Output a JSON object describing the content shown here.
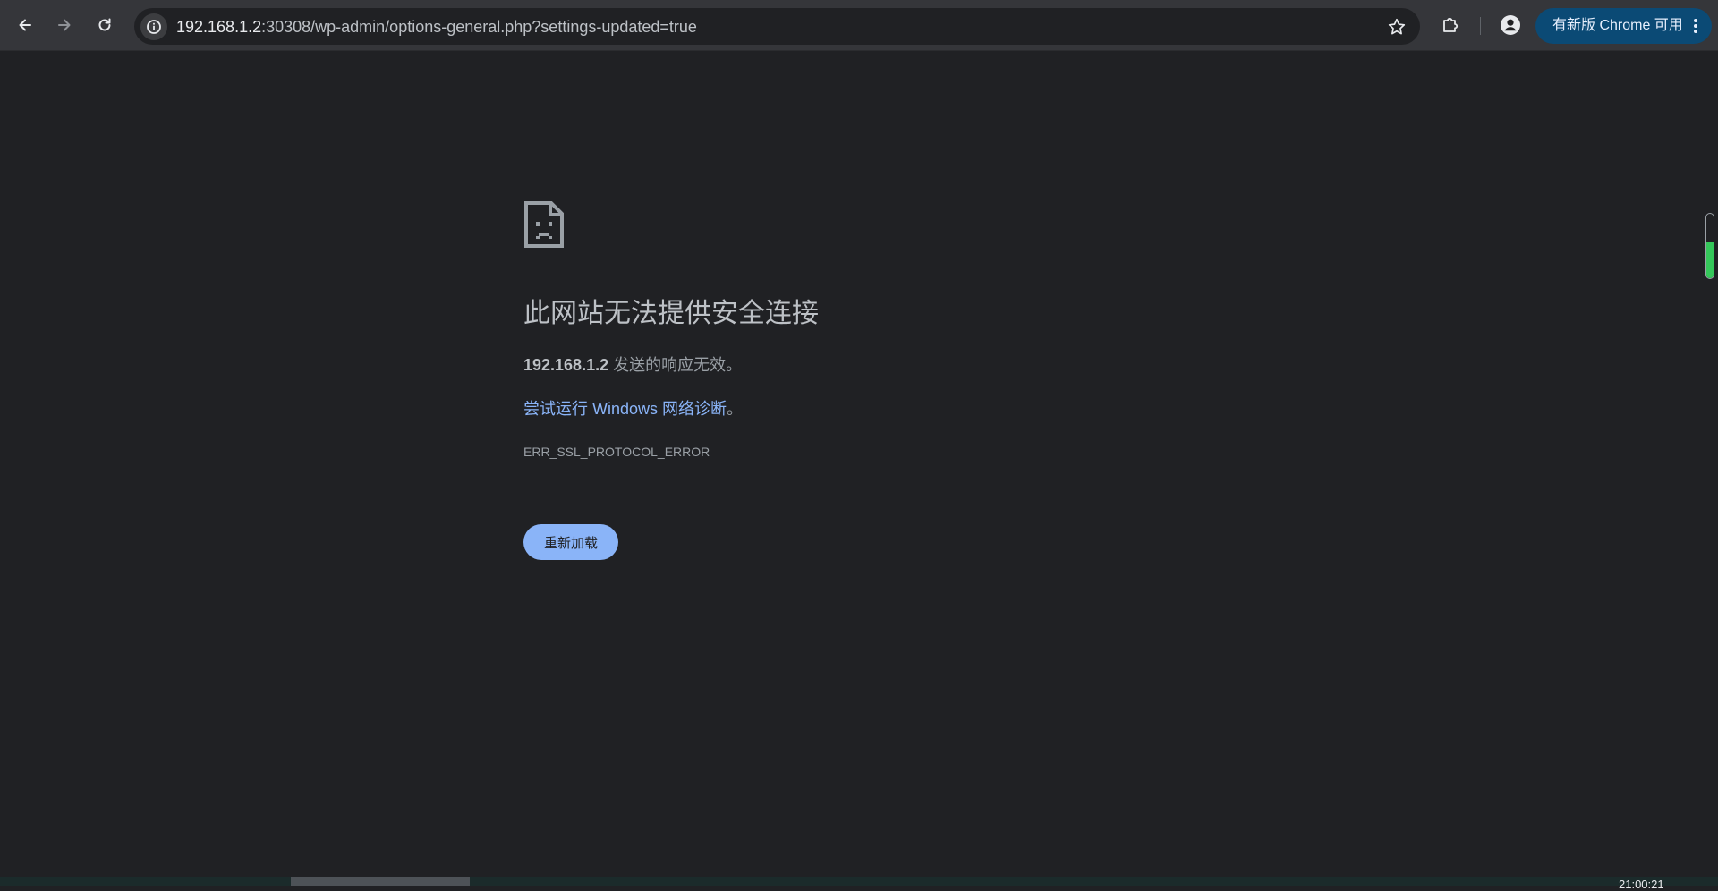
{
  "browser": {
    "url": "192.168.1.2:30308/wp-admin/options-general.php?settings-updated=true",
    "url_host": "192.168.1.2",
    "url_rest": ":30308/wp-admin/options-general.php?settings-updated=true",
    "update_chip_label": "有新版 Chrome 可用",
    "icons": {
      "back": "arrow-left-icon",
      "forward": "arrow-right-icon",
      "reload": "reload-icon",
      "site_info": "info-icon",
      "bookmark": "star-icon",
      "extensions": "puzzle-icon",
      "profile": "person-icon",
      "menu": "kebab-menu-icon"
    }
  },
  "error_page": {
    "icon": "sad-page-icon",
    "title": "此网站无法提供安全连接",
    "host": "192.168.1.2",
    "description_suffix": " 发送的响应无效。",
    "diagnostic_link": "尝试运行 Windows 网络诊断",
    "diagnostic_suffix": "。",
    "error_code": "ERR_SSL_PROTOCOL_ERROR",
    "reload_label": "重新加载"
  },
  "taskbar": {
    "clock_fragment": "21:00:21"
  },
  "colors": {
    "page_background": "#202124",
    "toolbar": "#35363a",
    "link": "#8ab4f8",
    "button": "#8ab4f8",
    "update_chip": "#0b4a75"
  }
}
